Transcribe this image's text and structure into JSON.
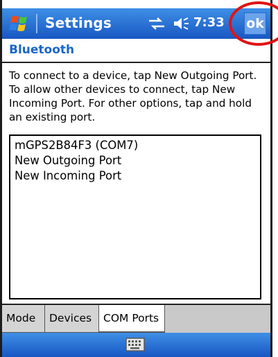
{
  "titlebar": {
    "title": "Settings",
    "clock": "7:33",
    "ok_label": "ok",
    "start_icon": "windows-start-icon",
    "connectivity_icon": "connectivity-icon",
    "volume_icon": "speaker-icon"
  },
  "page": {
    "subtitle": "Bluetooth",
    "instructions": "To connect to a device, tap New Outgoing Port. To allow other devices to connect, tap New Incoming Port. For other options, tap and hold an existing port."
  },
  "ports": [
    "mGPS2B84F3 (COM7)",
    "New Outgoing Port",
    "New Incoming Port"
  ],
  "tabs": [
    {
      "label": "Mode"
    },
    {
      "label": "Devices"
    },
    {
      "label": "COM Ports"
    }
  ],
  "active_tab": "COM Ports",
  "bottombar": {
    "icon": "keyboard-icon"
  },
  "colors": {
    "titlebar_top": "#3f8fe6",
    "titlebar_bottom": "#1857c2",
    "subtitle": "#1a66c8",
    "highlight_circle": "#e01414"
  }
}
